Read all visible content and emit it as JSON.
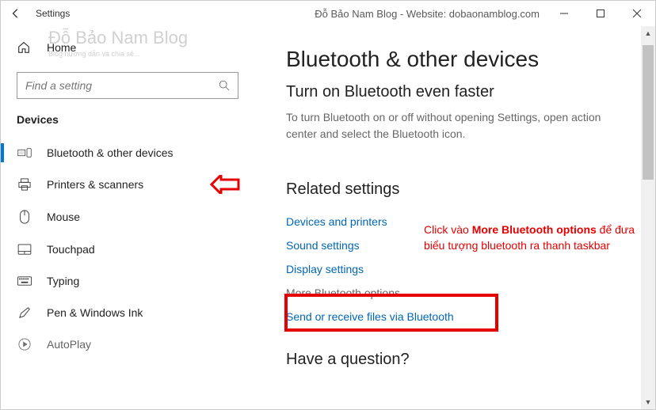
{
  "titlebar": {
    "title": "Settings",
    "brand": "Đỗ Bảo Nam Blog - Website: dobaonamblog.com"
  },
  "watermark": {
    "title": "Đỗ Bảo Nam Blog",
    "sub": "Blog hướng dẫn và chia sẻ..."
  },
  "home": {
    "label": "Home"
  },
  "search": {
    "placeholder": "Find a setting"
  },
  "section": "Devices",
  "nav": {
    "items": [
      {
        "label": "Bluetooth & other devices"
      },
      {
        "label": "Printers & scanners"
      },
      {
        "label": "Mouse"
      },
      {
        "label": "Touchpad"
      },
      {
        "label": "Typing"
      },
      {
        "label": "Pen & Windows Ink"
      },
      {
        "label": "AutoPlay"
      }
    ]
  },
  "main": {
    "h1": "Bluetooth & other devices",
    "h2": "Turn on Bluetooth even faster",
    "desc": "To turn Bluetooth on or off without opening Settings, open action center and select the Bluetooth icon.",
    "related_h": "Related settings",
    "links": {
      "devices": "Devices and printers",
      "sound": "Sound settings",
      "display": "Display settings",
      "more_bt": "More Bluetooth options",
      "send": "Send or receive files via Bluetooth"
    },
    "question": "Have a question?"
  },
  "annotation": {
    "text_pre": "Click vào ",
    "text_bold": "More Bluetooth options",
    "text_post": " để đưa biểu tượng bluetooth ra thanh taskbar"
  }
}
